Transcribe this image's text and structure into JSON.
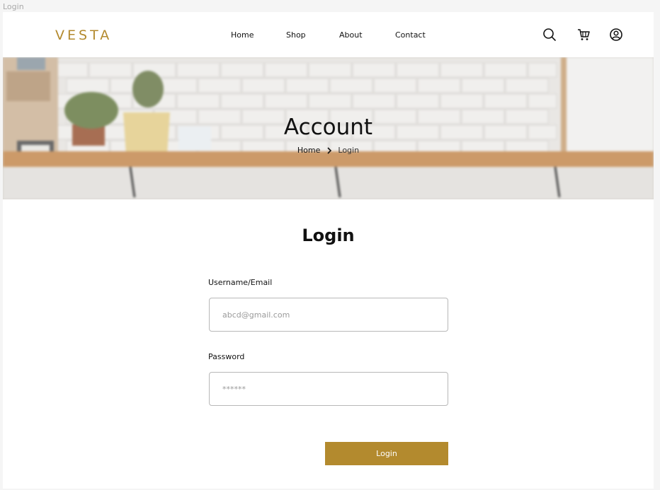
{
  "frame": {
    "label": "Login"
  },
  "brand": {
    "name": "VESTA",
    "accent_color": "#b38a2e"
  },
  "nav": {
    "items": [
      "Home",
      "Shop",
      "About",
      "Contact"
    ]
  },
  "header_icons": [
    "search-icon",
    "cart-icon",
    "user-account-icon"
  ],
  "hero": {
    "title": "Account",
    "breadcrumb": {
      "home": "Home",
      "current": "Login"
    }
  },
  "login": {
    "title": "Login",
    "username_label": "Username/Email",
    "username_placeholder": "abcd@gmail.com",
    "password_label": "Password",
    "password_placeholder": "******",
    "submit_label": "Login"
  }
}
